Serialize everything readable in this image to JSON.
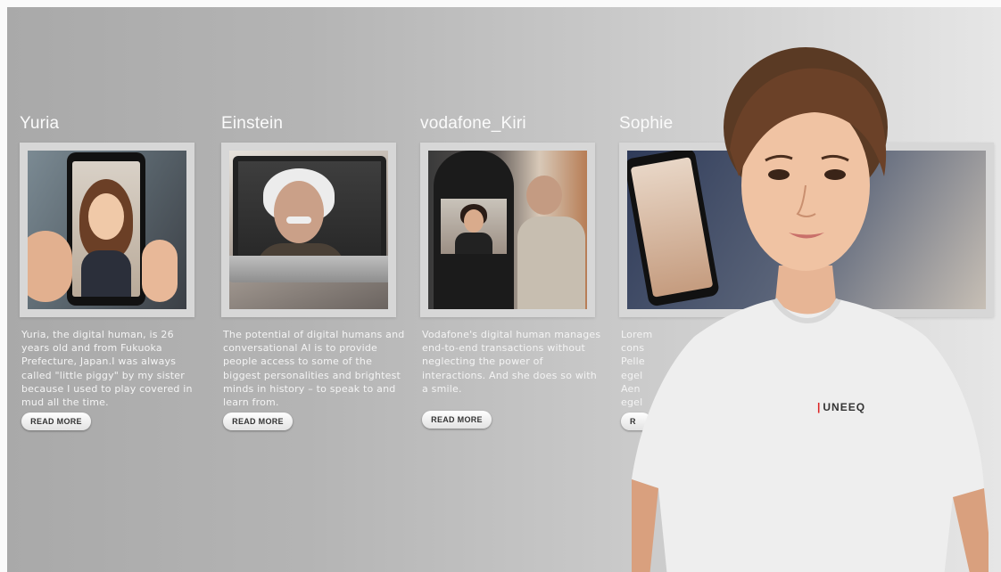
{
  "cards": [
    {
      "title": "Yuria",
      "description": "Yuria, the digital human, is 26 years old and from Fukuoka Prefecture, Japan.I was always called \"little piggy\" by my sister because I used to play covered in mud all the time.",
      "button": "READ MORE"
    },
    {
      "title": "Einstein",
      "description": "The potential of digital humans and conversational AI is to provide people access to some of the biggest personalities and brightest minds in history – to speak to and learn from.",
      "button": "READ MORE"
    },
    {
      "title": "vodafone_Kiri",
      "description": "Vodafone's digital human manages end-to-end transactions without neglecting the power of interactions. And she does so with a smile.",
      "button": "READ MORE"
    },
    {
      "title": "Sophie",
      "description": "Lorem\ncons\nPelle\negel\nAen\negel",
      "button": "R"
    }
  ],
  "presenter": {
    "shirt_logo": "UNEEQ"
  },
  "icons": {
    "logo_mark": "uneeq-logo-icon"
  }
}
